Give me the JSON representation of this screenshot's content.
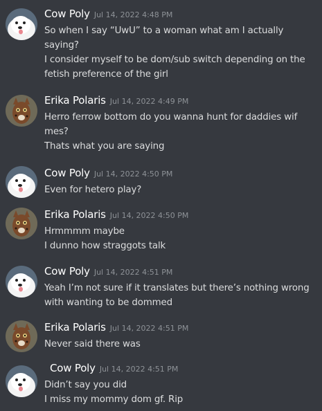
{
  "messages": [
    {
      "author": "Cow Poly",
      "timestamp": "Jul 14, 2022 4:48 PM",
      "avatar_icon": "samoyed-dog-avatar",
      "lines": [
        "So when I say “UwU” to a woman what am I actually",
        "saying?",
        "I consider myself to be dom/sub switch depending on the",
        "fetish preference of the girl"
      ]
    },
    {
      "author": "Erika Polaris",
      "timestamp": "Jul 14, 2022 4:49 PM",
      "avatar_icon": "cat-portrait-avatar",
      "lines": [
        "Herro ferrow bottom do you wanna hunt for daddies wif",
        "mes?",
        "Thats what you are saying"
      ]
    },
    {
      "author": "Cow Poly",
      "timestamp": "Jul 14, 2022 4:50 PM",
      "avatar_icon": "samoyed-dog-avatar",
      "lines": [
        "Even for hetero play?"
      ]
    },
    {
      "author": "Erika Polaris",
      "timestamp": "Jul 14, 2022 4:50 PM",
      "avatar_icon": "cat-portrait-avatar",
      "lines": [
        "Hrmmmm maybe",
        "I dunno how straggots talk"
      ]
    },
    {
      "author": "Cow Poly",
      "timestamp": "Jul 14, 2022 4:51 PM",
      "avatar_icon": "samoyed-dog-avatar",
      "lines": [
        "Yeah I’m not sure if it translates but there’s nothing wrong",
        "with wanting to be dommed"
      ]
    },
    {
      "author": "Erika Polaris",
      "timestamp": "Jul 14, 2022 4:51 PM",
      "avatar_icon": "cat-portrait-avatar",
      "lines": [
        "Never said there was"
      ]
    },
    {
      "author": "Cow Poly",
      "timestamp": "Jul 14, 2022 4:51 PM",
      "avatar_icon": "samoyed-dog-avatar",
      "lines": [
        "Didn’t say you did",
        "I miss my mommy dom gf. Rip"
      ]
    }
  ],
  "colors": {
    "background": "#36393f",
    "author_name": "#ffffff",
    "timestamp": "#8e9297",
    "message_text": "#dcddde"
  }
}
